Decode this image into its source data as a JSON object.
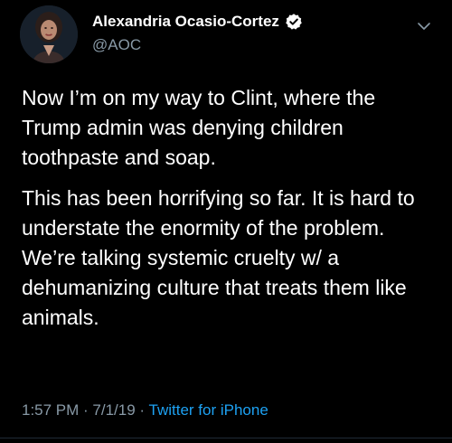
{
  "user": {
    "display_name": "Alexandria Ocasio-Cortez",
    "handle": "@AOC",
    "avatar_icon": "profile-photo",
    "verified_icon": "verified-badge-icon"
  },
  "tweet": {
    "paragraphs": [
      "Now I’m on my way to Clint, where the Trump admin was denying children toothpaste and soap.",
      "This has been horrifying so far. It is hard to understate the enormity of the problem. We’re talking systemic cruelty w/ a dehumanizing culture that treats them like animals."
    ],
    "time": "1:57 PM",
    "separator_1": " · ",
    "date": "7/1/19",
    "separator_2": " · ",
    "source": "Twitter for iPhone"
  },
  "colors": {
    "background": "#000000",
    "text": "#ffffff",
    "secondary": "#8899a6",
    "link": "#1da1f2"
  }
}
